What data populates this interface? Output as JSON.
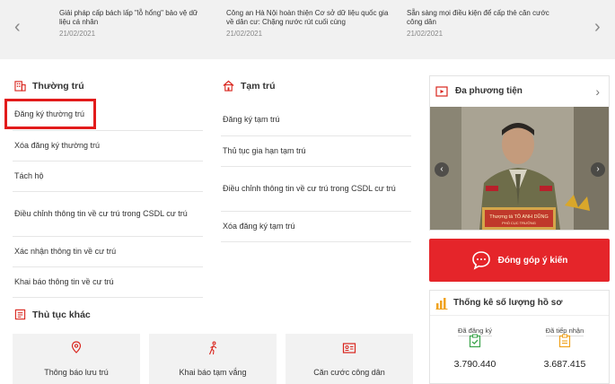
{
  "news": {
    "prev_icon": "chevron-left-icon",
    "next_icon": "chevron-right-icon",
    "items": [
      {
        "title": "Giải pháp cấp bách lấp \"lỗ hổng\" bảo vệ dữ liệu cá nhân",
        "date": "21/02/2021"
      },
      {
        "title": "Công an Hà Nội hoàn thiện Cơ sở dữ liệu quốc gia về dân cư: Chặng nước rút cuối cùng",
        "date": "21/02/2021"
      },
      {
        "title": "Sẵn sàng mọi điều kiện để cấp thẻ căn cước công dân",
        "date": "21/02/2021"
      }
    ]
  },
  "thuong_tru": {
    "title": "Thường trú",
    "items": [
      "Đăng ký thường trú",
      "Xóa đăng ký thường trú",
      "Tách hộ",
      "Điều chỉnh thông tin về cư trú trong CSDL cư trú",
      "Xác nhận thông tin về cư trú",
      "Khai báo thông tin về cư trú"
    ]
  },
  "tam_tru": {
    "title": "Tạm trú",
    "items": [
      "Đăng ký tạm trú",
      "Thủ tục gia hạn tạm trú",
      "Điều chỉnh thông tin về cư trú trong CSDL cư trú",
      "Xóa đăng ký tạm trú"
    ]
  },
  "thu_tuc_khac": {
    "title": "Thủ tục khác",
    "tiles": [
      "Thông báo lưu trú",
      "Khai báo tạm vắng",
      "Căn cước công dân"
    ]
  },
  "media": {
    "title": "Đa phương tiện",
    "nameplate": "Thượng tá TÔ ANH DŨNG",
    "nameplate_sub": "PHÓ CỤC TRƯỞNG"
  },
  "feedback": {
    "label": "Đóng góp ý kiến"
  },
  "stats": {
    "title": "Thống kê số lượng hồ sơ",
    "registered_label": "Đã đăng ký",
    "registered_value": "3.790.440",
    "received_label": "Đã tiếp nhận",
    "received_value": "3.687.415"
  },
  "colors": {
    "accent": "#e5252a",
    "icon_red": "#d9251d",
    "icon_green": "#3aa34a",
    "icon_orange": "#f0a21c"
  }
}
